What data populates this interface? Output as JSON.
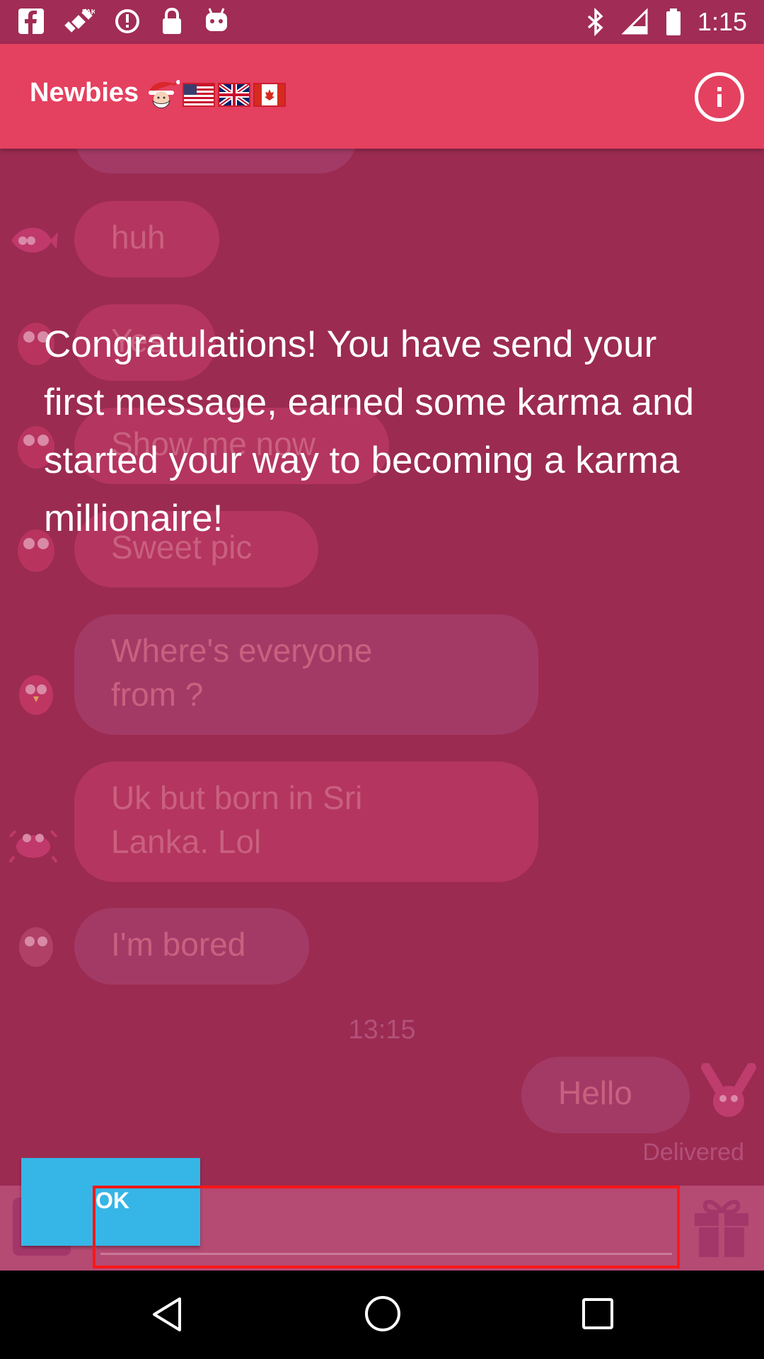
{
  "status_bar": {
    "time": "1:15",
    "icons_left": [
      "facebook-icon",
      "fake-gps-icon",
      "data-saver-icon",
      "lock-icon",
      "android-icon"
    ],
    "icons_right": [
      "bluetooth-icon",
      "no-signal-icon",
      "battery-icon"
    ]
  },
  "header": {
    "title": "Newbies",
    "decoration_icons": [
      "santa-emoji-icon",
      "us-flag-icon",
      "uk-flag-icon",
      "canada-flag-icon"
    ],
    "info_icon": "info-icon"
  },
  "messages": [
    {
      "text": "huh",
      "avatar": "fish-avatar-icon"
    },
    {
      "text": "Yes",
      "avatar": "owl-avatar-icon"
    },
    {
      "text": "Show me now",
      "avatar": "owl-avatar-icon"
    },
    {
      "text": "Sweet pic",
      "avatar": "owl-avatar-icon"
    },
    {
      "text": "Where's everyone from ?",
      "avatar": "bird-avatar-icon"
    },
    {
      "text": "Uk but born in Sri Lanka. Lol",
      "avatar": "crab-avatar-icon"
    },
    {
      "text": "I'm bored",
      "avatar": "owl-avatar-icon"
    }
  ],
  "time_label": "13:15",
  "own_message": {
    "text": "Hello",
    "status": "Delivered",
    "avatar": "bunny-avatar-icon"
  },
  "overlay": {
    "message": "Congratulations! You have send your first message, earned some karma and started your way to becoming a karma millionaire!",
    "ok_label": "OK"
  },
  "input": {
    "placeholder": "",
    "gift_icon": "gift-icon"
  },
  "nav": {
    "back": "back-icon",
    "home": "home-icon",
    "recents": "recents-icon"
  },
  "colors": {
    "header": "#e4405f",
    "background": "#9b2b51",
    "ok_button": "#36b6e6",
    "highlight": "#ff1717"
  }
}
